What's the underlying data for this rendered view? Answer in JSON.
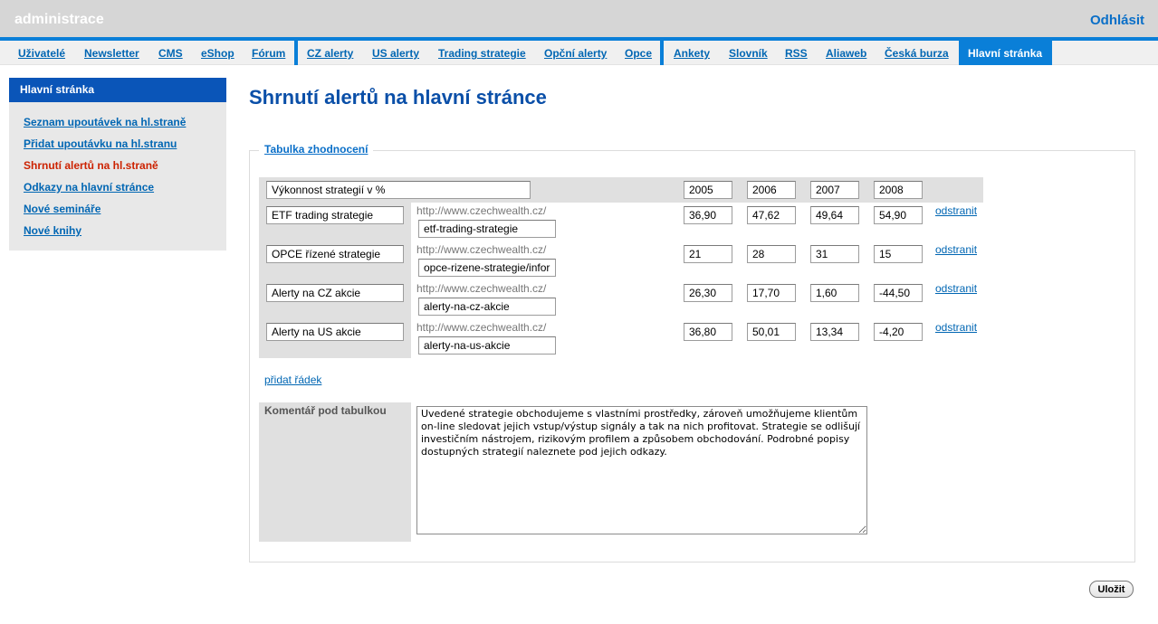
{
  "header": {
    "app_title": "administrace",
    "logout": "Odhlásit"
  },
  "nav": {
    "items": [
      "Uživatelé",
      "Newsletter",
      "CMS",
      "eShop",
      "Fórum",
      "CZ alerty",
      "US alerty",
      "Trading strategie",
      "Opční alerty",
      "Opce",
      "Ankety",
      "Slovník",
      "RSS",
      "Aliaweb",
      "Česká burza",
      "Hlavní stránka"
    ],
    "active": "Hlavní stránka"
  },
  "sidebar": {
    "title": "Hlavní stránka",
    "links": [
      "Seznam upoutávek na hl.straně",
      "Přidat upoutávku na hl.stranu",
      "Shrnutí alertů na hl.straně",
      "Odkazy na hlavní stránce",
      "Nové semináře",
      "Nové knihy"
    ],
    "current": "Shrnutí alertů na hl.straně"
  },
  "main": {
    "title": "Shrnutí alertů na hlavní stránce",
    "fieldset_legend": "Tabulka zhodnocení",
    "header_row": {
      "label": "Výkonnost strategií v %",
      "years": [
        "2005",
        "2006",
        "2007",
        "2008"
      ]
    },
    "url_prefix": "http://www.czechwealth.cz/",
    "remove_label": "odstranit",
    "rows": [
      {
        "name": "ETF trading strategie",
        "slug": "etf-trading-strategie",
        "values": [
          "36,90",
          "47,62",
          "49,64",
          "54,90"
        ]
      },
      {
        "name": "OPCE řízené strategie",
        "slug": "opce-rizene-strategie/informace",
        "values": [
          "21",
          "28",
          "31",
          "15"
        ]
      },
      {
        "name": "Alerty na CZ akcie",
        "slug": "alerty-na-cz-akcie",
        "values": [
          "26,30",
          "17,70",
          "1,60",
          "-44,50"
        ]
      },
      {
        "name": "Alerty na US akcie",
        "slug": "alerty-na-us-akcie",
        "values": [
          "36,80",
          "50,01",
          "13,34",
          "-4,20"
        ]
      }
    ],
    "add_row": "přidat řádek",
    "comment_label": "Komentář pod tabulkou",
    "comment_text": "Uvedené strategie obchodujeme s vlastními prostředky, zároveň umožňujeme klientům on-line sledovat jejich vstup/výstup signály a tak na nich profitovat. Strategie se odlišují investičním nástrojem, rizikovým profilem a způsobem obchodování. Podrobné popisy dostupných strategií naleznete pod jejich odkazy.",
    "save_button": "Uložit"
  }
}
